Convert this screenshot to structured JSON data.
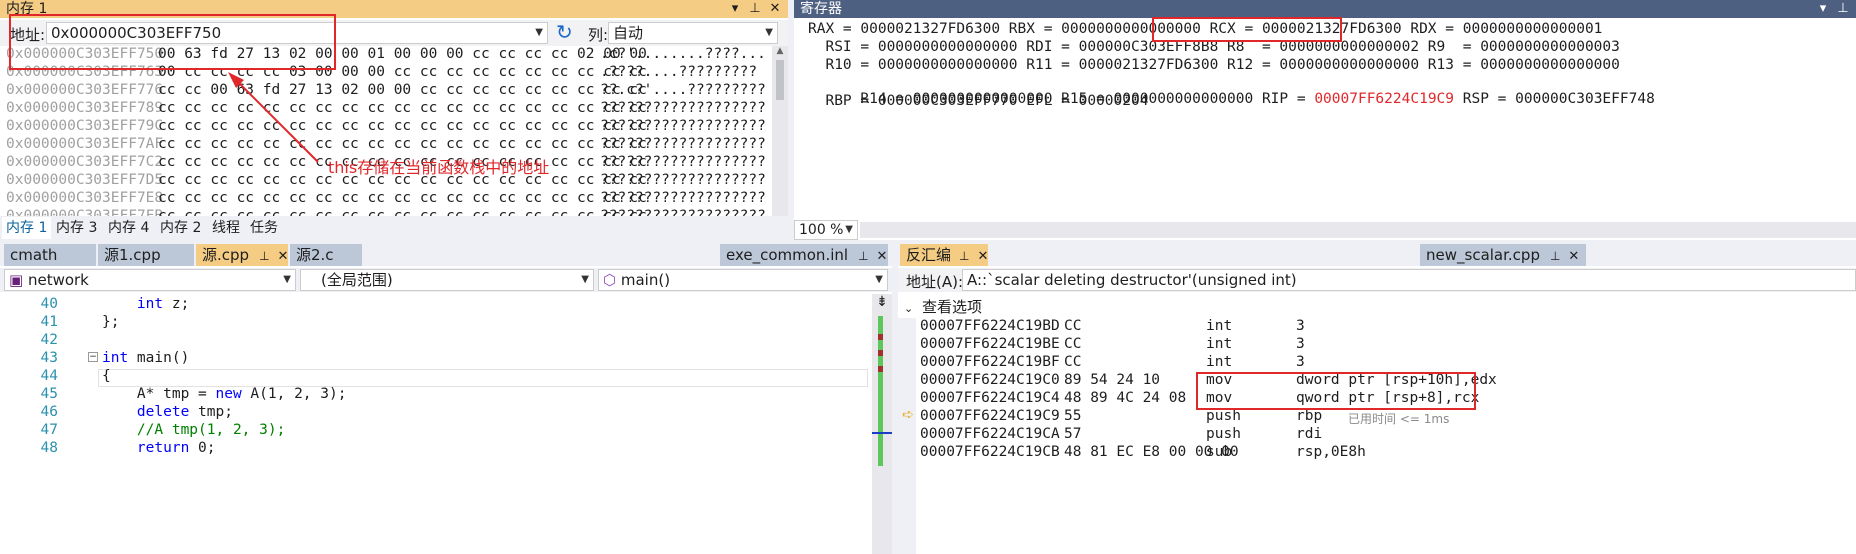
{
  "memory": {
    "title": "内存 1",
    "address_label": "地址:",
    "address_value": "0x000000C303EFF750",
    "columns_label": "列:",
    "columns_value": "自动",
    "rows": [
      {
        "addr": "0x000000C303EFF750",
        "bytes": "00 63 fd 27 13 02 00 00 01 00 00 00 cc cc cc cc 02 00 00",
        "ascii": ".c?'........????..."
      },
      {
        "addr": "0x000000C303EFF763",
        "bytes": "00 cc cc cc cc 03 00 00 00 cc cc cc cc cc cc cc cc cc cc",
        "ascii": ".????....?????????"
      },
      {
        "addr": "0x000000C303EFF776",
        "bytes": "cc cc 00 63 fd 27 13 02 00 00 cc cc cc cc cc cc cc cc cc",
        "ascii": "??.c?'....?????????"
      },
      {
        "addr": "0x000000C303EFF789",
        "bytes": "cc cc cc cc cc cc cc cc cc cc cc cc cc cc cc cc cc cc cc",
        "ascii": "???????????????????"
      },
      {
        "addr": "0x000000C303EFF79C",
        "bytes": "cc cc cc cc cc cc cc cc cc cc cc cc cc cc cc cc cc cc cc",
        "ascii": "???????????????????"
      },
      {
        "addr": "0x000000C303EFF7AF",
        "bytes": "cc cc cc cc cc cc cc cc cc cc cc cc cc cc cc cc cc cc cc",
        "ascii": "???????????????????"
      },
      {
        "addr": "0x000000C303EFF7C2",
        "bytes": "cc cc cc cc cc cc cc cc cc cc cc cc cc cc cc cc cc cc cc",
        "ascii": "???????????????????"
      },
      {
        "addr": "0x000000C303EFF7D5",
        "bytes": "cc cc cc cc cc cc cc cc cc cc cc cc cc cc cc cc cc cc cc",
        "ascii": "???????????????????"
      },
      {
        "addr": "0x000000C303EFF7E8",
        "bytes": "cc cc cc cc cc cc cc cc cc cc cc cc cc cc cc cc cc cc cc",
        "ascii": "???????????????????"
      },
      {
        "addr": "0x000000C303EFF7FB",
        "bytes": "cc cc cc cc cc cc cc cc cc cc cc cc cc cc cc cc cc cc cc",
        "ascii": "???????????????????"
      }
    ],
    "annotation": "this存储在当前函数栈中的地址",
    "tabs": [
      "内存 1",
      "内存 3",
      "内存 4",
      "内存 2",
      "线程",
      "任务"
    ]
  },
  "registers": {
    "title": "寄存器",
    "lines": [
      "RAX = 0000021327FD6300 RBX = 0000000000000000 RCX = 0000021327FD6300 RDX = 0000000000000001",
      "  RSI = 0000000000000000 RDI = 000000C303EFF8B8 R8  = 0000000000000002 R9  = 0000000000000003",
      "  R10 = 0000000000000000 R11 = 0000021327FD6300 R12 = 0000000000000000 R13 = 0000000000000000",
      "  R14 = 0000000000000000 R15 = 0000000000000000 RIP = ",
      "  RBP = 000000C303EFF770 EFL = 00000204"
    ],
    "rip_value": "00007FF6224C19C9",
    "rsp_text": " RSP = 000000C303EFF748",
    "zoom": "100 %"
  },
  "editor": {
    "tabs": [
      "cmath",
      "源1.cpp",
      "源.cpp",
      "源2.c"
    ],
    "right_tab": "exe_common.inl",
    "project": "network",
    "scope": "(全局范围)",
    "function": "main()",
    "lines": [
      {
        "num": "40",
        "code": "    int z;"
      },
      {
        "num": "41",
        "code": "};"
      },
      {
        "num": "42",
        "code": ""
      },
      {
        "num": "43",
        "code": "int main()"
      },
      {
        "num": "44",
        "code": "{"
      },
      {
        "num": "45",
        "code": "    A* tmp = new A(1, 2, 3);"
      },
      {
        "num": "46",
        "code": "    delete tmp;"
      },
      {
        "num": "47",
        "code": "    //A tmp(1, 2, 3);"
      },
      {
        "num": "48",
        "code": "    return 0;"
      }
    ]
  },
  "disasm": {
    "title": "反汇编",
    "right_tab": "new_scalar.cpp",
    "address_label": "地址(A):",
    "address_value": "A::`scalar deleting destructor'(unsigned int)",
    "view_options": "查看选项",
    "rows": [
      {
        "addr": "00007FF6224C19BD",
        "bytes": "CC",
        "op": "int",
        "arg": "3"
      },
      {
        "addr": "00007FF6224C19BE",
        "bytes": "CC",
        "op": "int",
        "arg": "3"
      },
      {
        "addr": "00007FF6224C19BF",
        "bytes": "CC",
        "op": "int",
        "arg": "3"
      },
      {
        "addr": "00007FF6224C19C0",
        "bytes": "89 54 24 10",
        "op": "mov",
        "arg": "dword ptr [rsp+10h],edx"
      },
      {
        "addr": "00007FF6224C19C4",
        "bytes": "48 89 4C 24 08",
        "op": "mov",
        "arg": "qword ptr [rsp+8],rcx"
      },
      {
        "addr": "00007FF6224C19C9",
        "bytes": "55",
        "op": "push",
        "arg": "rbp"
      },
      {
        "addr": "00007FF6224C19CA",
        "bytes": "57",
        "op": "push",
        "arg": "rdi"
      },
      {
        "addr": "00007FF6224C19CB",
        "bytes": "48 81 EC E8 00 00 00",
        "op": "sub",
        "arg": "rsp,0E8h"
      }
    ],
    "elapsed": "已用时间 <= 1ms"
  }
}
